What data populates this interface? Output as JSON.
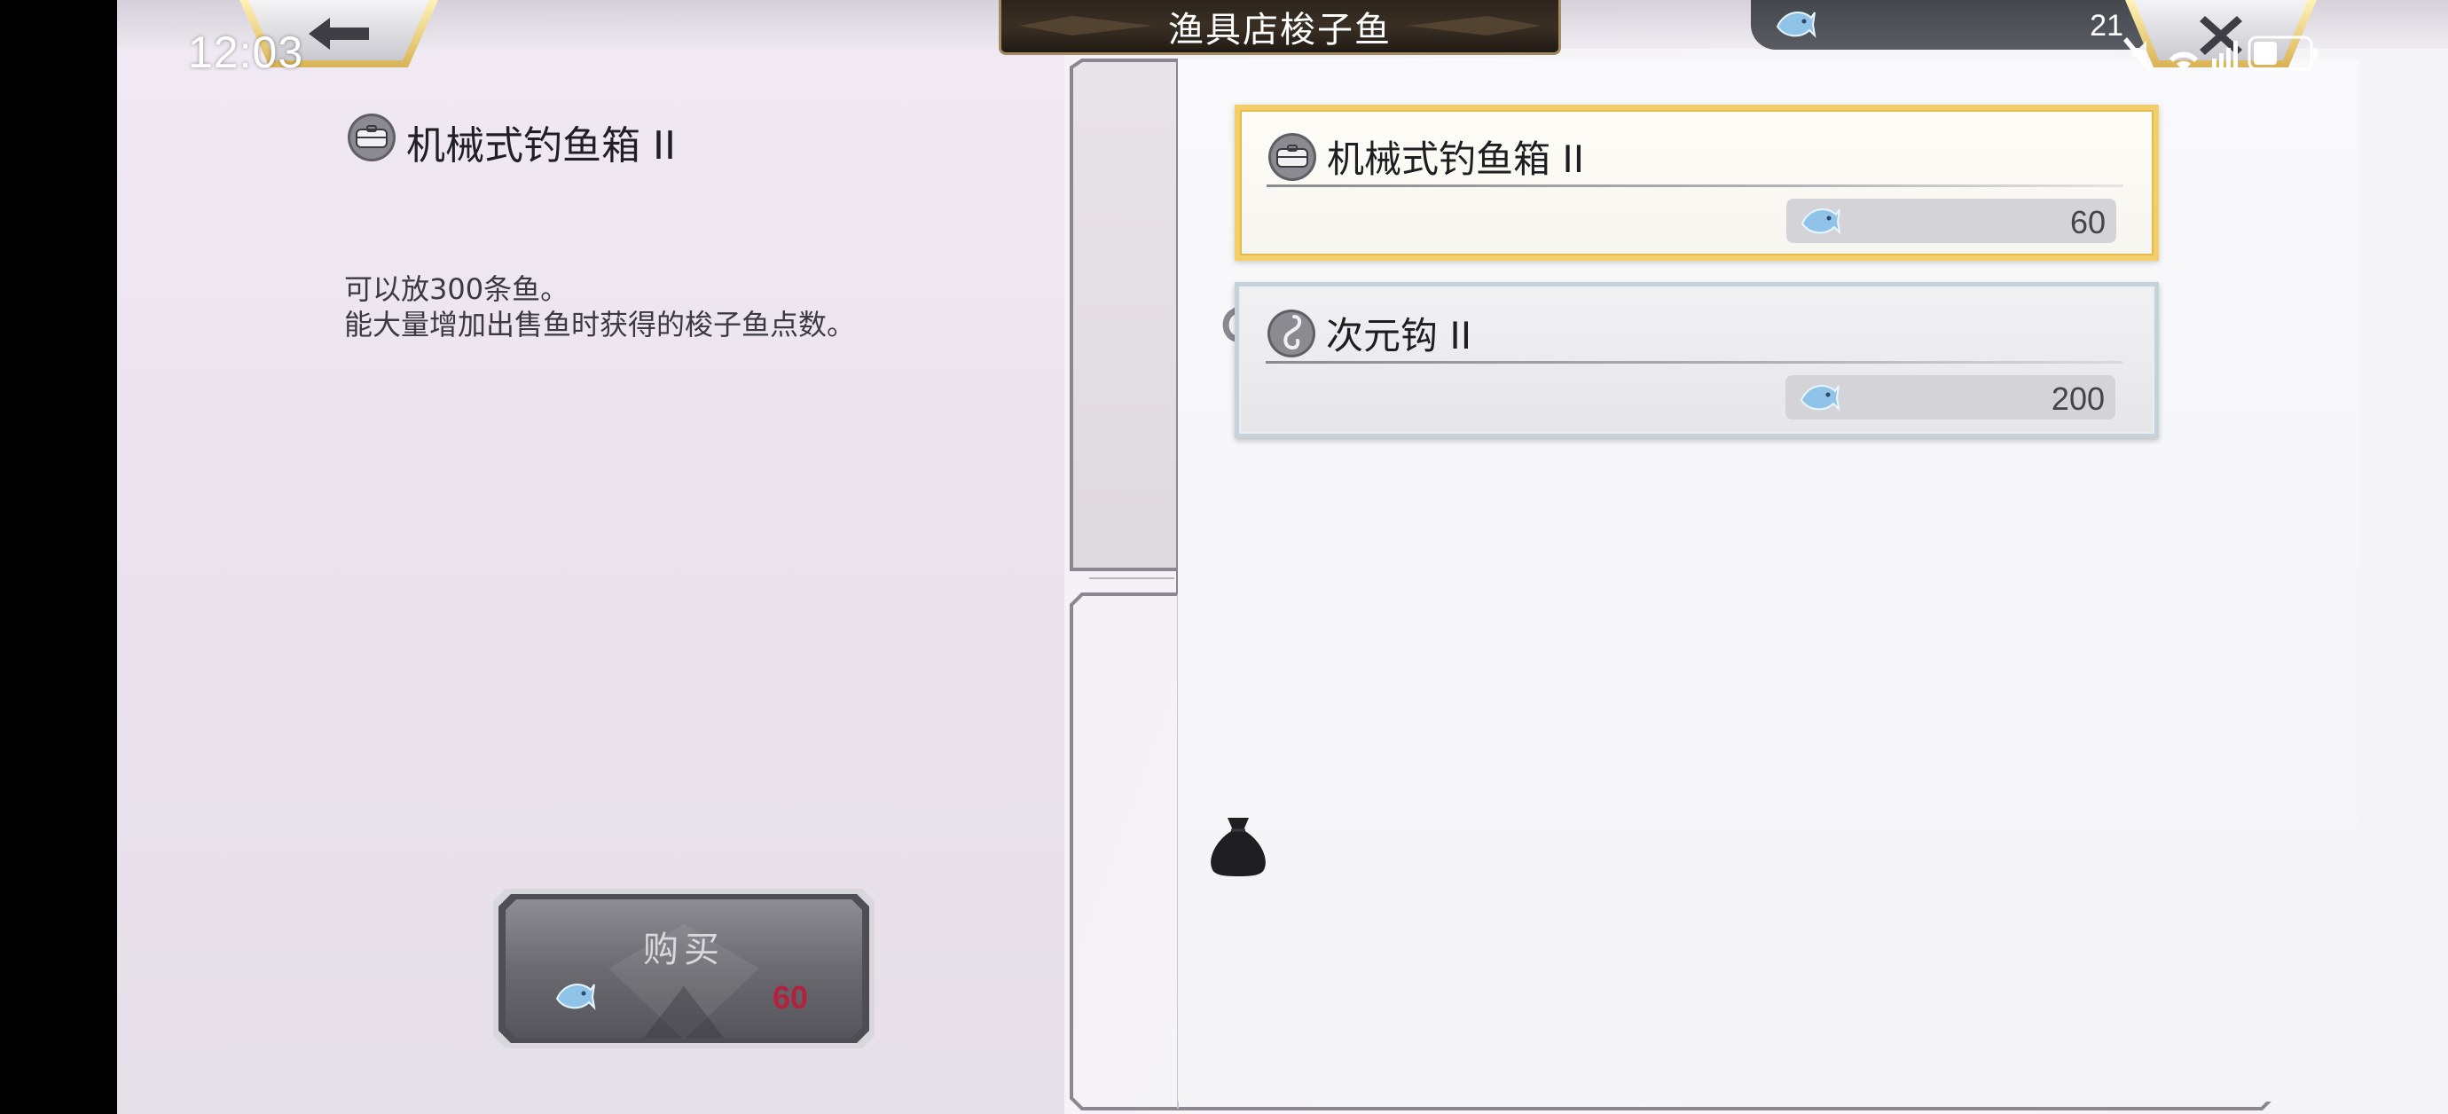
{
  "status_bar": {
    "time": "12:03"
  },
  "header": {
    "title": "渔具店梭子鱼",
    "currency_value": "21",
    "back_icon": "back-arrow-icon",
    "close_icon": "close-x-icon"
  },
  "detail": {
    "item_name": "机械式钓鱼箱 II",
    "description_lines": [
      "可以放300条鱼。",
      "能大量增加出售鱼时获得的梭子鱼点数。"
    ]
  },
  "buy_button": {
    "label": "购买",
    "price": "60",
    "price_color": "#b3213d"
  },
  "categories": [
    {
      "icon": "hook-icon",
      "selected": true
    },
    {
      "icon": "bag-icon",
      "selected": false
    }
  ],
  "shop_items": [
    {
      "name": "机械式钓鱼箱 II",
      "price": "60",
      "icon": "tackle-box-icon",
      "selected": true
    },
    {
      "name": "次元钩 II",
      "price": "200",
      "icon": "hook-icon",
      "selected": false
    }
  ],
  "colors": {
    "selected_border": "#f3cf6b",
    "title_plate": "#2c241c",
    "currency_fish": "#8fc3e8"
  }
}
